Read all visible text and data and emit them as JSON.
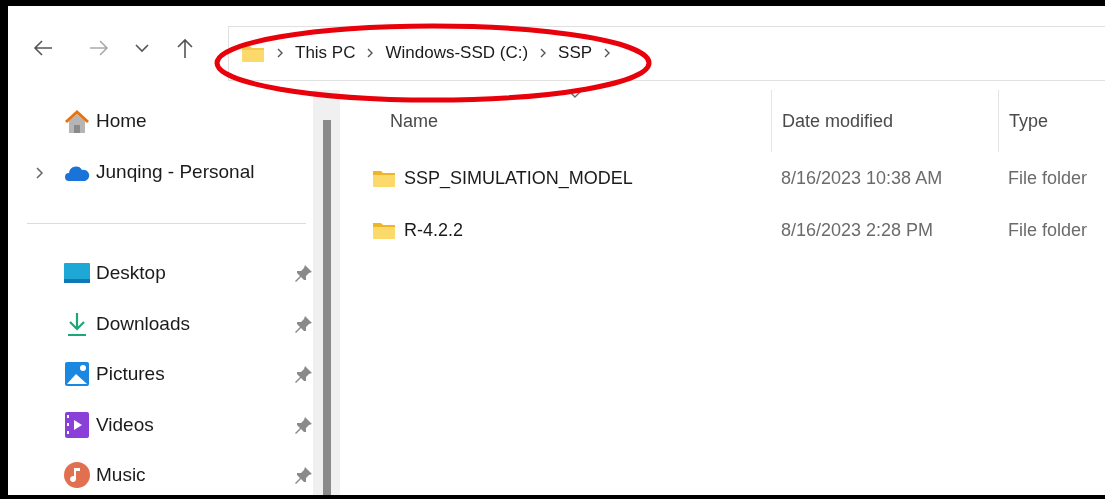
{
  "breadcrumb": [
    "This PC",
    "Windows-SSD (C:)",
    "SSP"
  ],
  "sidebar": {
    "top_items": [
      {
        "label": "Home"
      },
      {
        "label": "Junqing - Personal",
        "expanded": false
      }
    ],
    "quick_access": [
      {
        "label": "Desktop",
        "pinned": true
      },
      {
        "label": "Downloads",
        "pinned": true
      },
      {
        "label": "Pictures",
        "pinned": true
      },
      {
        "label": "Videos",
        "pinned": true
      },
      {
        "label": "Music",
        "pinned": true
      }
    ]
  },
  "table": {
    "columns": [
      {
        "label": "Name",
        "sorted": true
      },
      {
        "label": "Date modified",
        "sorted": false
      },
      {
        "label": "Type",
        "sorted": false
      }
    ],
    "rows": [
      {
        "name": "SSP_SIMULATION_MODEL",
        "date_modified": "8/16/2023 10:38 AM",
        "type": "File folder"
      },
      {
        "name": "R-4.2.2",
        "date_modified": "8/16/2023 2:28 PM",
        "type": "File folder"
      }
    ]
  },
  "annotation": {
    "kind": "ellipse"
  }
}
